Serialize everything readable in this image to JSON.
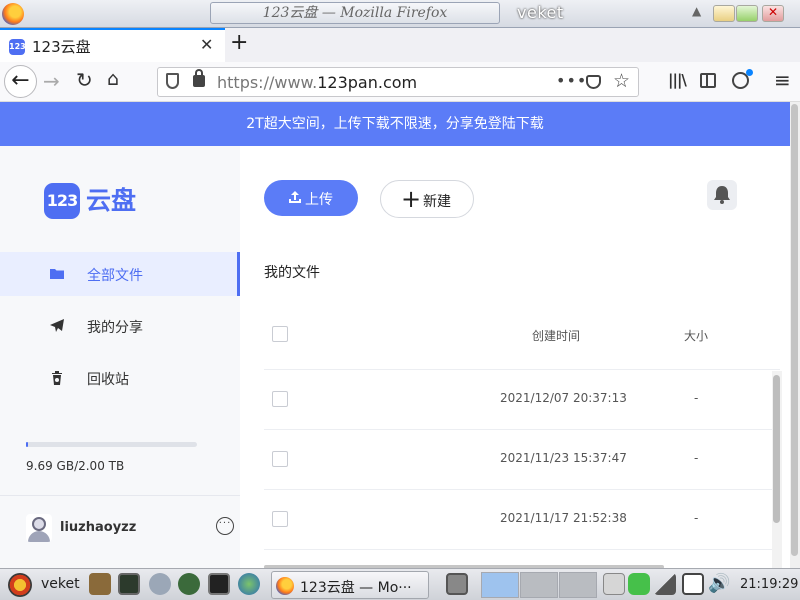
{
  "window": {
    "title": "123云盘 — Mozilla Firefox",
    "wm_name": "veket"
  },
  "browser": {
    "tab_title": "123云盘",
    "url_prefix": "https://www.",
    "url_host": "123pan.com",
    "url_dots": "•••"
  },
  "page": {
    "banner": "2T超大空间，上传下载不限速，分享免登陆下载",
    "logo_mark": "123",
    "logo_text": "云盘",
    "sidebar": {
      "items": [
        {
          "label": "全部文件",
          "icon": "folder-icon",
          "active": true
        },
        {
          "label": "我的分享",
          "icon": "send-icon",
          "active": false
        },
        {
          "label": "回收站",
          "icon": "trash-icon",
          "active": false
        }
      ],
      "storage_text": "9.69 GB/2.00 TB",
      "storage_fraction": 0.005,
      "username": "liuzhaoyzz",
      "more_label": "···"
    },
    "toolbar": {
      "upload_label": "上传",
      "new_label": "新建"
    },
    "section_title": "我的文件",
    "table": {
      "headers": {
        "created": "创建时间",
        "size": "大小"
      },
      "rows": [
        {
          "created": "2021/12/07 20:37:13",
          "size": "-"
        },
        {
          "created": "2021/11/23 15:37:47",
          "size": "-"
        },
        {
          "created": "2021/11/17 21:52:38",
          "size": "-"
        }
      ]
    },
    "accent_color": "#5b7cf7"
  },
  "taskbar": {
    "start_label": "veket",
    "task_label": "123云盘 — Mo···",
    "clock": "21:19:29"
  }
}
